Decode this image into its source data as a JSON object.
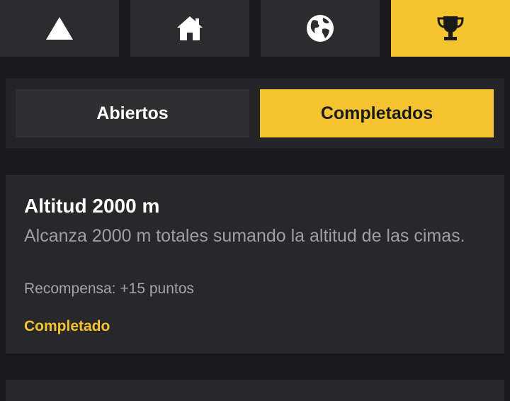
{
  "nav": {
    "tabs": [
      {
        "icon": "mountain-icon",
        "active": false
      },
      {
        "icon": "home-icon",
        "active": false
      },
      {
        "icon": "globe-icon",
        "active": false
      },
      {
        "icon": "trophy-icon",
        "active": true
      }
    ]
  },
  "segments": {
    "open_label": "Abiertos",
    "completed_label": "Completados",
    "selected": "Completados"
  },
  "challenge": {
    "title": "Altitud 2000 m",
    "description": "Alcanza 2000 m totales sumando la altitud de las cimas.",
    "reward": "Recompensa: +15 puntos",
    "status": "Completado"
  },
  "colors": {
    "accent": "#f4c430",
    "background": "#1a1a1c",
    "card": "#28282a",
    "tab": "#2c2c2e"
  }
}
